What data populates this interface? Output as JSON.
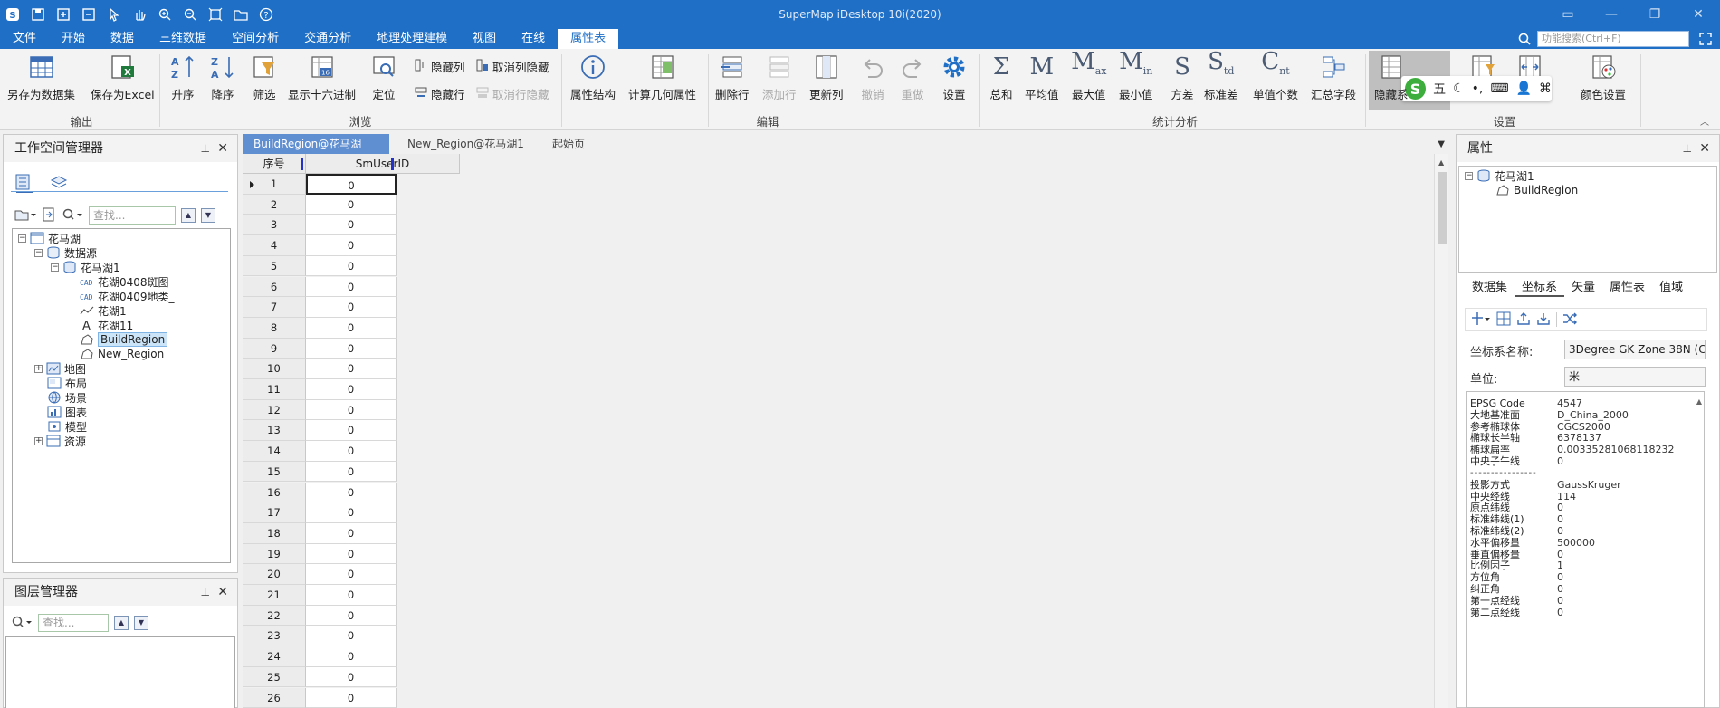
{
  "title_bar": {
    "app_title": "SuperMap iDesktop 10i(2020)"
  },
  "menu": {
    "items": [
      {
        "label": "文件"
      },
      {
        "label": "开始"
      },
      {
        "label": "数据"
      },
      {
        "label": "三维数据"
      },
      {
        "label": "空间分析"
      },
      {
        "label": "交通分析"
      },
      {
        "label": "地理处理建模"
      },
      {
        "label": "视图"
      },
      {
        "label": "在线"
      },
      {
        "label": "属性表",
        "active": true
      }
    ],
    "search_placeholder": "功能搜索(Ctrl+F)"
  },
  "ribbon": {
    "groups": {
      "output": "输出",
      "browse": "浏览",
      "edit": "编辑",
      "stats": "统计分析",
      "settings": "设置"
    },
    "output": {
      "save_dataset": "另存为数据集",
      "save_excel": "保存为Excel"
    },
    "browse": {
      "ascending": "升序",
      "descending": "降序",
      "filter": "筛选",
      "hex": "显示十六进制",
      "locate": "定位",
      "hide_col": "隐藏列",
      "unhide_col": "取消列隐藏",
      "hide_row": "隐藏行",
      "unhide_row": "取消行隐藏"
    },
    "edit": {
      "attr_structure": "属性结构",
      "calc_geometry": "计算几何属性",
      "delete_row": "删除行",
      "add_row": "添加行",
      "update_col": "更新列",
      "undo": "撤销",
      "redo": "重做",
      "settings": "设置"
    },
    "stats": {
      "sum": "总和",
      "mean": "平均值",
      "max": "最大值",
      "min": "最小值",
      "variance": "方差",
      "std": "标准差",
      "count": "单值个数",
      "summary": "汇总字段"
    },
    "settings": {
      "hide_system": "隐藏系",
      "settings": "设置",
      "color_settings": "颜色设置"
    }
  },
  "ime": {
    "mode": "五",
    "logo": "S"
  },
  "workspace_panel": {
    "title": "工作空间管理器",
    "find_placeholder": "查找...",
    "tree": {
      "root": "花马湖",
      "datasource_group": "数据源",
      "datasource": "花马湖1",
      "datasets": [
        "花湖0408斑图",
        "花湖0409地类_",
        "花湖1",
        "花湖11",
        "BuildRegion",
        "New_Region"
      ],
      "selected": "BuildRegion",
      "other": [
        "地图",
        "布局",
        "场景",
        "图表",
        "模型",
        "资源"
      ]
    }
  },
  "layer_panel": {
    "title": "图层管理器",
    "find_placeholder": "查找..."
  },
  "doc_tabs": [
    {
      "label": "BuildRegion@花马湖1",
      "active": true
    },
    {
      "label": "New_Region@花马湖1"
    },
    {
      "label": "起始页"
    }
  ],
  "grid": {
    "col_index": "序号",
    "col_field": "SmUserID",
    "rows": [
      [
        "1",
        "0"
      ],
      [
        "2",
        "0"
      ],
      [
        "3",
        "0"
      ],
      [
        "4",
        "0"
      ],
      [
        "5",
        "0"
      ],
      [
        "6",
        "0"
      ],
      [
        "7",
        "0"
      ],
      [
        "8",
        "0"
      ],
      [
        "9",
        "0"
      ],
      [
        "10",
        "0"
      ],
      [
        "11",
        "0"
      ],
      [
        "12",
        "0"
      ],
      [
        "13",
        "0"
      ],
      [
        "14",
        "0"
      ],
      [
        "15",
        "0"
      ],
      [
        "16",
        "0"
      ],
      [
        "17",
        "0"
      ],
      [
        "18",
        "0"
      ],
      [
        "19",
        "0"
      ],
      [
        "20",
        "0"
      ],
      [
        "21",
        "0"
      ],
      [
        "22",
        "0"
      ],
      [
        "23",
        "0"
      ],
      [
        "24",
        "0"
      ],
      [
        "25",
        "0"
      ],
      [
        "26",
        "0"
      ]
    ]
  },
  "properties_panel": {
    "title": "属性",
    "tree_root": "花马湖1",
    "tree_child": "BuildRegion",
    "tabs": [
      "数据集",
      "坐标系",
      "矢量",
      "属性表",
      "值域"
    ],
    "active_tab": "坐标系",
    "crs_name_label": "坐标系名称:",
    "crs_name_value": "3Degree GK Zone 38N   (CGC",
    "unit_label": "单位:",
    "unit_value": "米",
    "geo": [
      [
        "EPSG Code",
        "4547"
      ],
      [
        "大地基准面",
        "D_China_2000"
      ],
      [
        "参考椭球体",
        "CGCS2000"
      ],
      [
        "椭球长半轴",
        "6378137"
      ],
      [
        "椭球扁率",
        "0.00335281068118232"
      ],
      [
        "中央子午线",
        "0"
      ]
    ],
    "divider": "----------------",
    "proj": [
      [
        "投影方式",
        "GaussKruger"
      ],
      [
        "中央经线",
        "114"
      ],
      [
        "原点纬线",
        "0"
      ],
      [
        "标准纬线(1)",
        "0"
      ],
      [
        "标准纬线(2)",
        "0"
      ],
      [
        "水平偏移量",
        "500000"
      ],
      [
        "垂直偏移量",
        "0"
      ],
      [
        "比例因子",
        "1"
      ],
      [
        "方位角",
        "0"
      ],
      [
        "纠正角",
        "0"
      ],
      [
        "第一点经线",
        "0"
      ],
      [
        "第二点经线",
        "0"
      ]
    ]
  },
  "colors": {
    "accent": "#1f6fc6",
    "tab_active": "#5f8ed1",
    "tree_selected": "#cce4f7"
  }
}
